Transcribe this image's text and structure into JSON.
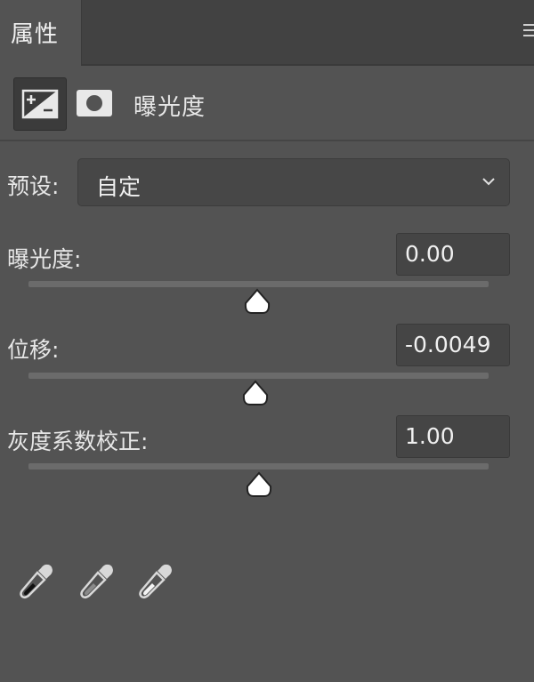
{
  "tabs": [
    {
      "label": "属性"
    }
  ],
  "header": {
    "title": "曝光度",
    "icons": [
      "exposure-adjustment-icon",
      "layer-mask-icon"
    ]
  },
  "preset": {
    "label": "预设:",
    "value": "自定"
  },
  "sliders": [
    {
      "label": "曝光度:",
      "value": "0.00",
      "position": 0.5
    },
    {
      "label": "位移:",
      "value": "-0.0049",
      "position": 0.5
    },
    {
      "label": "灰度系数校正:",
      "value": "1.00",
      "position": 0.5
    }
  ],
  "eyedroppers": [
    "black-point-eyedropper-icon",
    "gray-point-eyedropper-icon",
    "white-point-eyedropper-icon"
  ],
  "colors": {
    "panel_bg": "#535353",
    "tabbar_bg": "#424242",
    "field_bg": "#454545",
    "track": "#6b6b6b",
    "text": "#e6e6e6"
  }
}
